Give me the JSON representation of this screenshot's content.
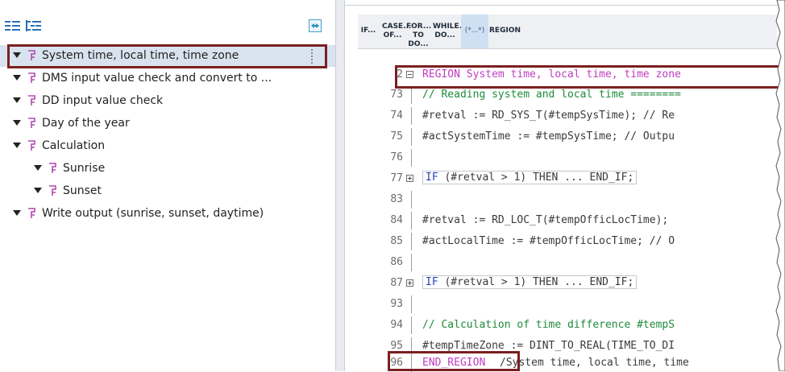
{
  "region_tree": {
    "toolbar": {
      "collapse_icon": "collapse-all-icon",
      "expand_icon": "expand-all-icon",
      "sync_icon": "sync-editor-icon"
    },
    "items": [
      {
        "label": "System time, local time, time zone",
        "level": 0,
        "selected": true
      },
      {
        "label": "DMS input value check and convert to ...",
        "level": 0
      },
      {
        "label": "DD input value check",
        "level": 0
      },
      {
        "label": "Day of the year",
        "level": 0
      },
      {
        "label": "Calculation",
        "level": 0
      },
      {
        "label": "Sunrise",
        "level": 1
      },
      {
        "label": "Sunset",
        "level": 1
      },
      {
        "label": "Write output (sunrise, sunset, daytime)",
        "level": 0
      }
    ]
  },
  "keyword_toolbar": {
    "buttons": [
      {
        "line1": "IF...",
        "line2": ""
      },
      {
        "line1": "CASE...",
        "line2": "OF..."
      },
      {
        "line1": "FOR...",
        "line2": "TO DO..."
      },
      {
        "line1": "WHILE...",
        "line2": "DO..."
      },
      {
        "line1": "(*...*)",
        "line2": ""
      },
      {
        "line1": "REGION",
        "line2": ""
      }
    ]
  },
  "code_editor": {
    "lines": [
      {
        "num": "2",
        "text": "REGION System time, local time, time zone",
        "style": "region",
        "fold": "minus"
      },
      {
        "num": "73",
        "text": "// Reading system and local time ========",
        "style": "comment"
      },
      {
        "num": "74",
        "text": "#retval := RD_SYS_T(#tempSysTime); // Re",
        "style": "code"
      },
      {
        "num": "75",
        "text": "#actSystemTime := #tempSysTime; // Outpu",
        "style": "code"
      },
      {
        "num": "76",
        "text": "",
        "style": "code"
      },
      {
        "num": "77",
        "text": "IF (#retval > 1) THEN ... END_IF;",
        "style": "if",
        "fold": "plus"
      },
      {
        "num": "83",
        "text": "",
        "style": "code"
      },
      {
        "num": "84",
        "text": "#retval := RD_LOC_T(#tempOfficLocTime);",
        "style": "code"
      },
      {
        "num": "85",
        "text": "#actLocalTime := #tempOfficLocTime; // O",
        "style": "code"
      },
      {
        "num": "86",
        "text": "",
        "style": "code"
      },
      {
        "num": "87",
        "text": "IF (#retval > 1) THEN ... END_IF;",
        "style": "if",
        "fold": "plus"
      },
      {
        "num": "93",
        "text": "",
        "style": "code"
      },
      {
        "num": "94",
        "text": "// Calculation of time difference #tempS",
        "style": "comment"
      },
      {
        "num": "95",
        "text": "#tempTimeZone := DINT_TO_REAL(TIME_TO_DI",
        "style": "code"
      },
      {
        "num": "96",
        "text": "END_REGION",
        "trailing": "/System time, local time, time",
        "style": "endregion"
      }
    ]
  },
  "colors": {
    "highlight_box": "#7b1f1f",
    "region_keyword": "#c23cc0",
    "comment": "#1e8a3a",
    "if_keyword": "#2a3fb8"
  }
}
